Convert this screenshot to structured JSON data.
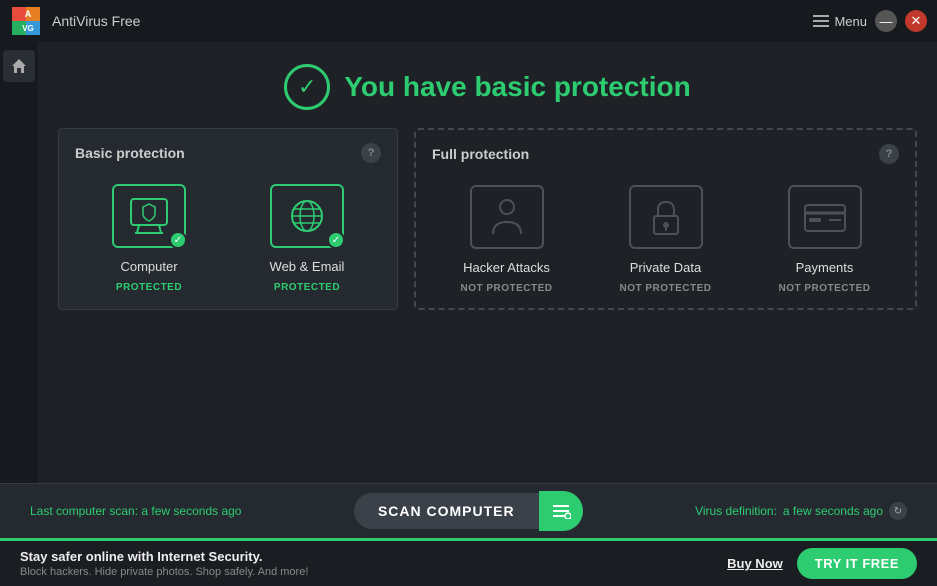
{
  "titleBar": {
    "appName": "AntiVirus Free",
    "menuLabel": "Menu",
    "minimizeLabel": "—",
    "closeLabel": "✕"
  },
  "hero": {
    "title": "You have basic protection",
    "checkmark": "✓"
  },
  "basicPanel": {
    "title": "Basic protection",
    "helpLabel": "?",
    "items": [
      {
        "name": "Computer",
        "status": "PROTECTED",
        "protected": true
      },
      {
        "name": "Web & Email",
        "status": "PROTECTED",
        "protected": true
      }
    ]
  },
  "fullPanel": {
    "title": "Full protection",
    "helpLabel": "?",
    "items": [
      {
        "name": "Hacker Attacks",
        "status": "NOT PROTECTED",
        "protected": false
      },
      {
        "name": "Private Data",
        "status": "NOT PROTECTED",
        "protected": false
      },
      {
        "name": "Payments",
        "status": "NOT PROTECTED",
        "protected": false
      }
    ]
  },
  "scanBar": {
    "lastScanLabel": "Last computer scan:",
    "lastScanTime": "a few seconds ago",
    "scanButtonLabel": "SCAN COMPUTER",
    "virusDefLabel": "Virus definition:",
    "virusDefTime": "a few seconds ago"
  },
  "bottomBar": {
    "title": "Stay safer online with Internet Security.",
    "subtitle": "Block hackers. Hide private photos. Shop safely. And more!",
    "buyNowLabel": "Buy Now",
    "tryFreeLabel": "TRY IT FREE"
  },
  "colors": {
    "green": "#2ecc71",
    "darkBg": "#1e2227",
    "panelBg": "#252a30",
    "inactive": "#4a5258"
  }
}
